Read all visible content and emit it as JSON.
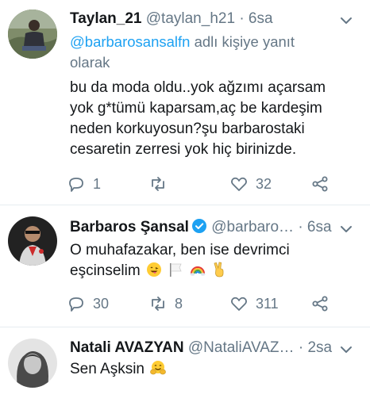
{
  "tweets": [
    {
      "name": "Taylan_21",
      "handle": "@taylan_h21",
      "dot": "·",
      "time": "6sa",
      "reply_mention": "@barbarosansalfn",
      "reply_suffix": " adlı kişiye yanıt olarak",
      "lines": [
        "bu da moda oldu..yok ağzımı açarsam",
        "yok g*tümü kaparsam,aç be kardeşim",
        "neden korkuyosun?şu barbarostaki",
        "cesaretin zerresi yok hiç birinizde."
      ],
      "replies": "1",
      "retweets": "",
      "likes": "32"
    },
    {
      "name": "Barbaros Şansal",
      "handle": "@barbaro…",
      "dot": "·",
      "time": "6sa",
      "lines": [
        "O muhafazakar, ben ise devrimci",
        "eşcinselim"
      ],
      "emojis": [
        "grinning-face-with-tongue",
        "white-flag",
        "rainbow",
        "victory-hand"
      ],
      "replies": "30",
      "retweets": "8",
      "likes": "311"
    },
    {
      "name": "Natali AVAZYAN",
      "handle": "@NataliAVAZ…",
      "dot": "·",
      "time": "2sa",
      "lines": [
        "Sen Aşksin"
      ],
      "emojis": [
        "hugging-face"
      ]
    }
  ],
  "colors": {
    "accent": "#1da1f2",
    "muted": "#657786",
    "text": "#14171a",
    "divider": "#e6ecf0"
  }
}
